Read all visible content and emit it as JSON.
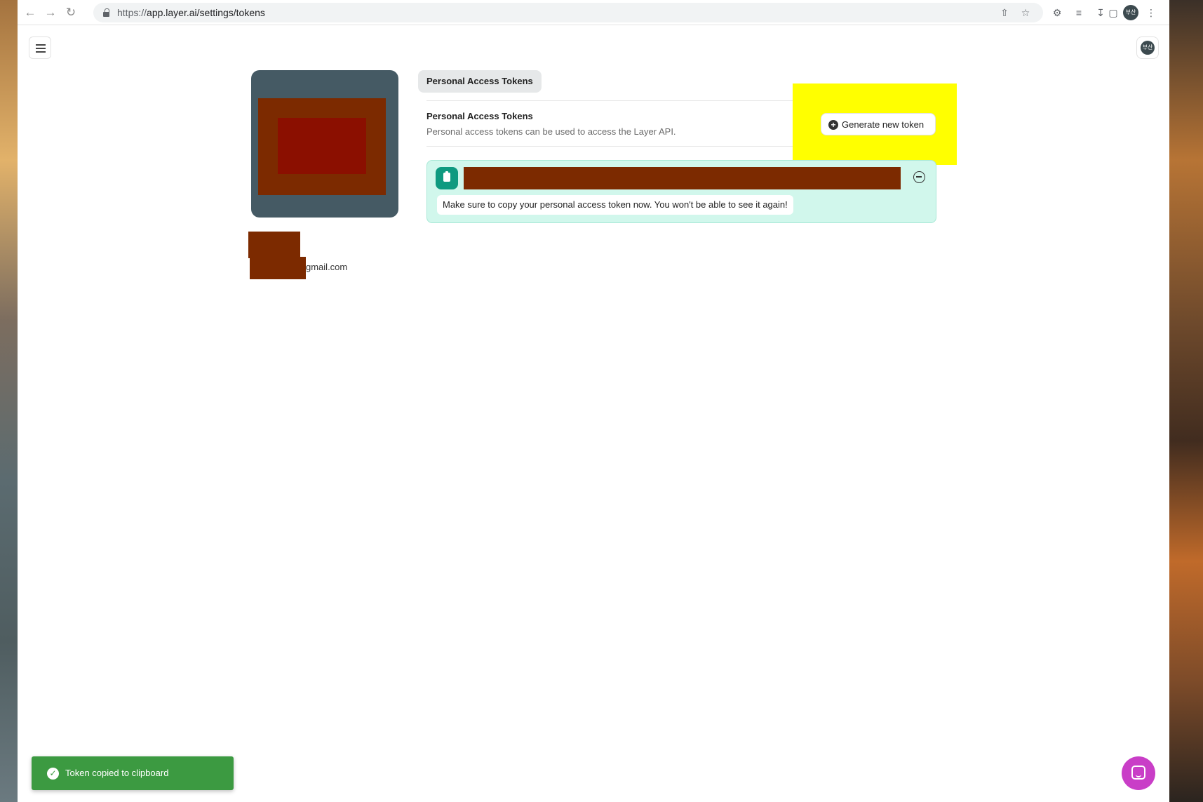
{
  "browser": {
    "url_scheme": "https://",
    "url_rest": "app.layer.ai/settings/tokens",
    "profile_initials": "부산",
    "icons": [
      "back-icon",
      "forward-icon",
      "reload-icon",
      "lock-icon",
      "share-icon",
      "bookmark-star-icon",
      "extensions-icon",
      "reading-list-icon",
      "download-icon",
      "side-panel-icon",
      "more-vert-icon"
    ]
  },
  "header": {
    "menu_icon": "hamburger-icon",
    "avatar_initials": "부산"
  },
  "profile": {
    "email_suffix": "gmail.com"
  },
  "tabs": [
    {
      "label": "Personal Access Tokens",
      "active": true
    }
  ],
  "section": {
    "title": "Personal Access Tokens",
    "description": "Personal access tokens can be used to access the Layer API.",
    "generate_button_label": "Generate new token"
  },
  "token_panel": {
    "warning": "Make sure to copy your personal access token now. You won't be able to see it again!"
  },
  "toast": {
    "message": "Token copied to clipboard"
  },
  "colors": {
    "accent_teal": "#0f9a80",
    "token_bg": "#d1f7ec",
    "toast_green": "#3c9a41",
    "chat_purple": "#c93ec7",
    "highlight_yellow": "#ffff00",
    "redaction": "#7c2a00"
  }
}
